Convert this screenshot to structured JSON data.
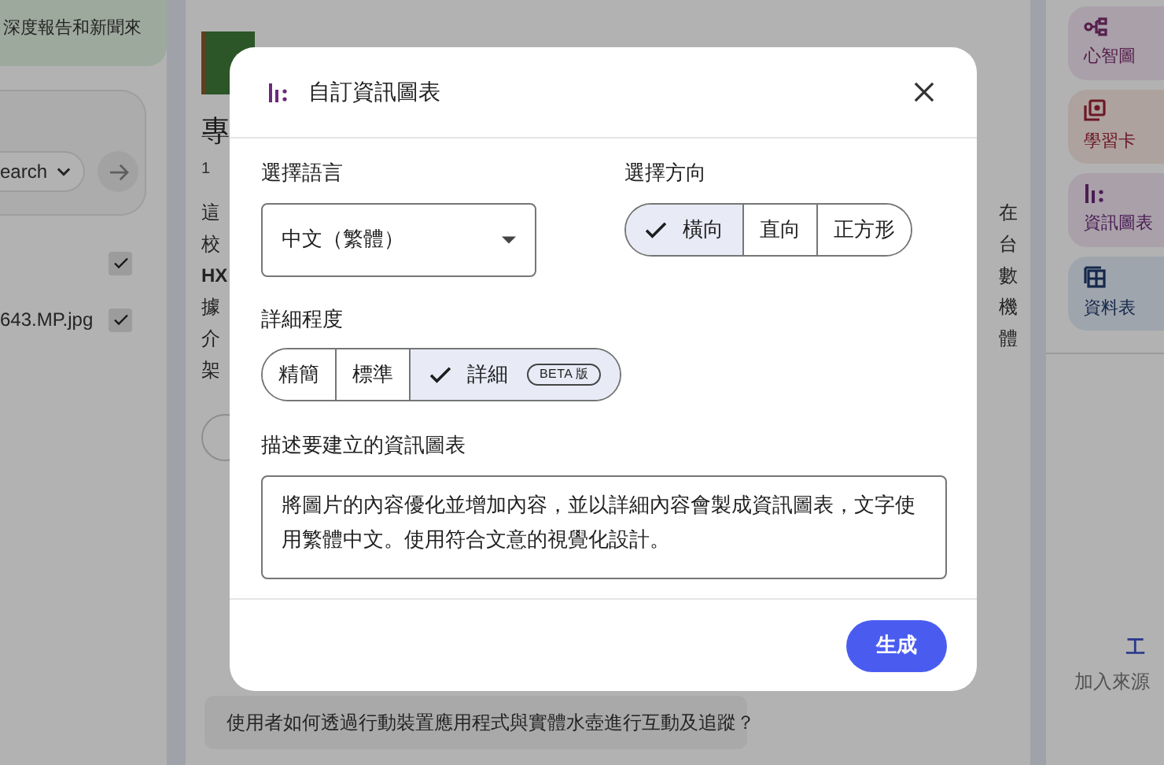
{
  "sources_panel": {
    "source_card": "深度報告和新聞來",
    "search_mode": "earch",
    "sources": [
      {
        "checked": true
      },
      {
        "name": "643.MP.jpg",
        "checked": true
      }
    ]
  },
  "chat_panel": {
    "title": "專",
    "count": "1",
    "lines_left": [
      "這",
      "校",
      "HX",
      "據",
      "介",
      "架"
    ],
    "lines_right": [
      "在",
      "台",
      "數",
      "機",
      "體"
    ],
    "question": "使用者如何透過行動裝置應用程式與實體水壺進行互動及追蹤？"
  },
  "studio_panel": {
    "tools": [
      {
        "kind": "mindmap",
        "label": "心智圖"
      },
      {
        "kind": "flashcards",
        "label": "學習卡"
      },
      {
        "kind": "infographic",
        "label": "資訊圖表"
      },
      {
        "kind": "table",
        "label": "資料表"
      }
    ],
    "empty_title": "工",
    "empty_text": "加入來源"
  },
  "dialog": {
    "title": "自訂資訊圖表",
    "language": {
      "label": "選擇語言",
      "value": "中文（繁體）"
    },
    "orientation": {
      "label": "選擇方向",
      "options": [
        {
          "label": "橫向",
          "selected": true
        },
        {
          "label": "直向",
          "selected": false
        },
        {
          "label": "正方形",
          "selected": false
        }
      ]
    },
    "detail": {
      "label": "詳細程度",
      "options": [
        {
          "label": "精簡",
          "selected": false
        },
        {
          "label": "標準",
          "selected": false
        },
        {
          "label": "詳細",
          "selected": true,
          "badge": "BETA 版"
        }
      ]
    },
    "description": {
      "label": "描述要建立的資訊圖表",
      "value": "將圖片的內容優化並增加內容，並以詳細內容會製成資訊圖表，文字使用繁體中文。使用符合文意的視覺化設計。"
    },
    "generate_button": "生成"
  }
}
